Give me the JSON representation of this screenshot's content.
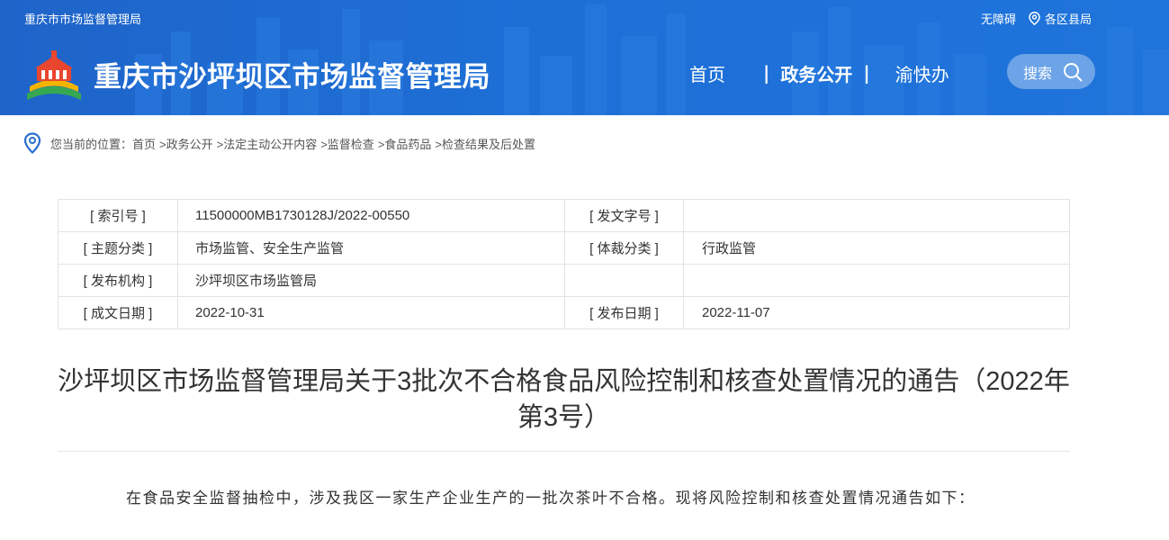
{
  "header": {
    "top_site_name": "重庆市市场监督管理局",
    "accessibility_label": "无障碍",
    "districts_label": "各区县局",
    "site_title": "重庆市沙坪坝区市场监督管理局",
    "nav": {
      "home": "首页",
      "sep": "|",
      "gov_affairs": "政务公开",
      "partial": "渝快办"
    },
    "search_label": "搜索"
  },
  "breadcrumb": {
    "prefix": "您当前的位置：",
    "items": [
      "首页",
      ">政务公开",
      ">法定主动公开内容",
      ">监督检查",
      ">食品药品",
      ">检查结果及后处置"
    ]
  },
  "meta": {
    "rows": [
      {
        "label1": "[ 索引号 ]",
        "value1": "11500000MB1730128J/2022-00550",
        "label2": "[ 发文字号 ]",
        "value2": ""
      },
      {
        "label1": "[ 主题分类 ]",
        "value1": "市场监管、安全生产监管",
        "label2": "[ 体裁分类 ]",
        "value2": "行政监管"
      },
      {
        "label1": "[ 发布机构 ]",
        "value1": "沙坪坝区市场监管局",
        "label2": "",
        "value2": ""
      },
      {
        "label1": "[ 成文日期 ]",
        "value1": "2022-10-31",
        "label2": "[ 发布日期 ]",
        "value2": "2022-11-07"
      }
    ]
  },
  "document": {
    "title": "沙坪坝区市场监督管理局关于3批次不合格食品风险控制和核查处置情况的通告（2022年第3号）",
    "body": "在食品安全监督抽检中，涉及我区一家生产企业生产的一批次茶叶不合格。现将风险控制和核查处置情况通告如下："
  },
  "colors": {
    "header_bg": "#1d6fd6",
    "breadcrumb_icon": "#2b6fd0"
  },
  "icons": [
    "location-pin-icon",
    "accessibility-icon",
    "search-icon",
    "logo-emblem"
  ]
}
